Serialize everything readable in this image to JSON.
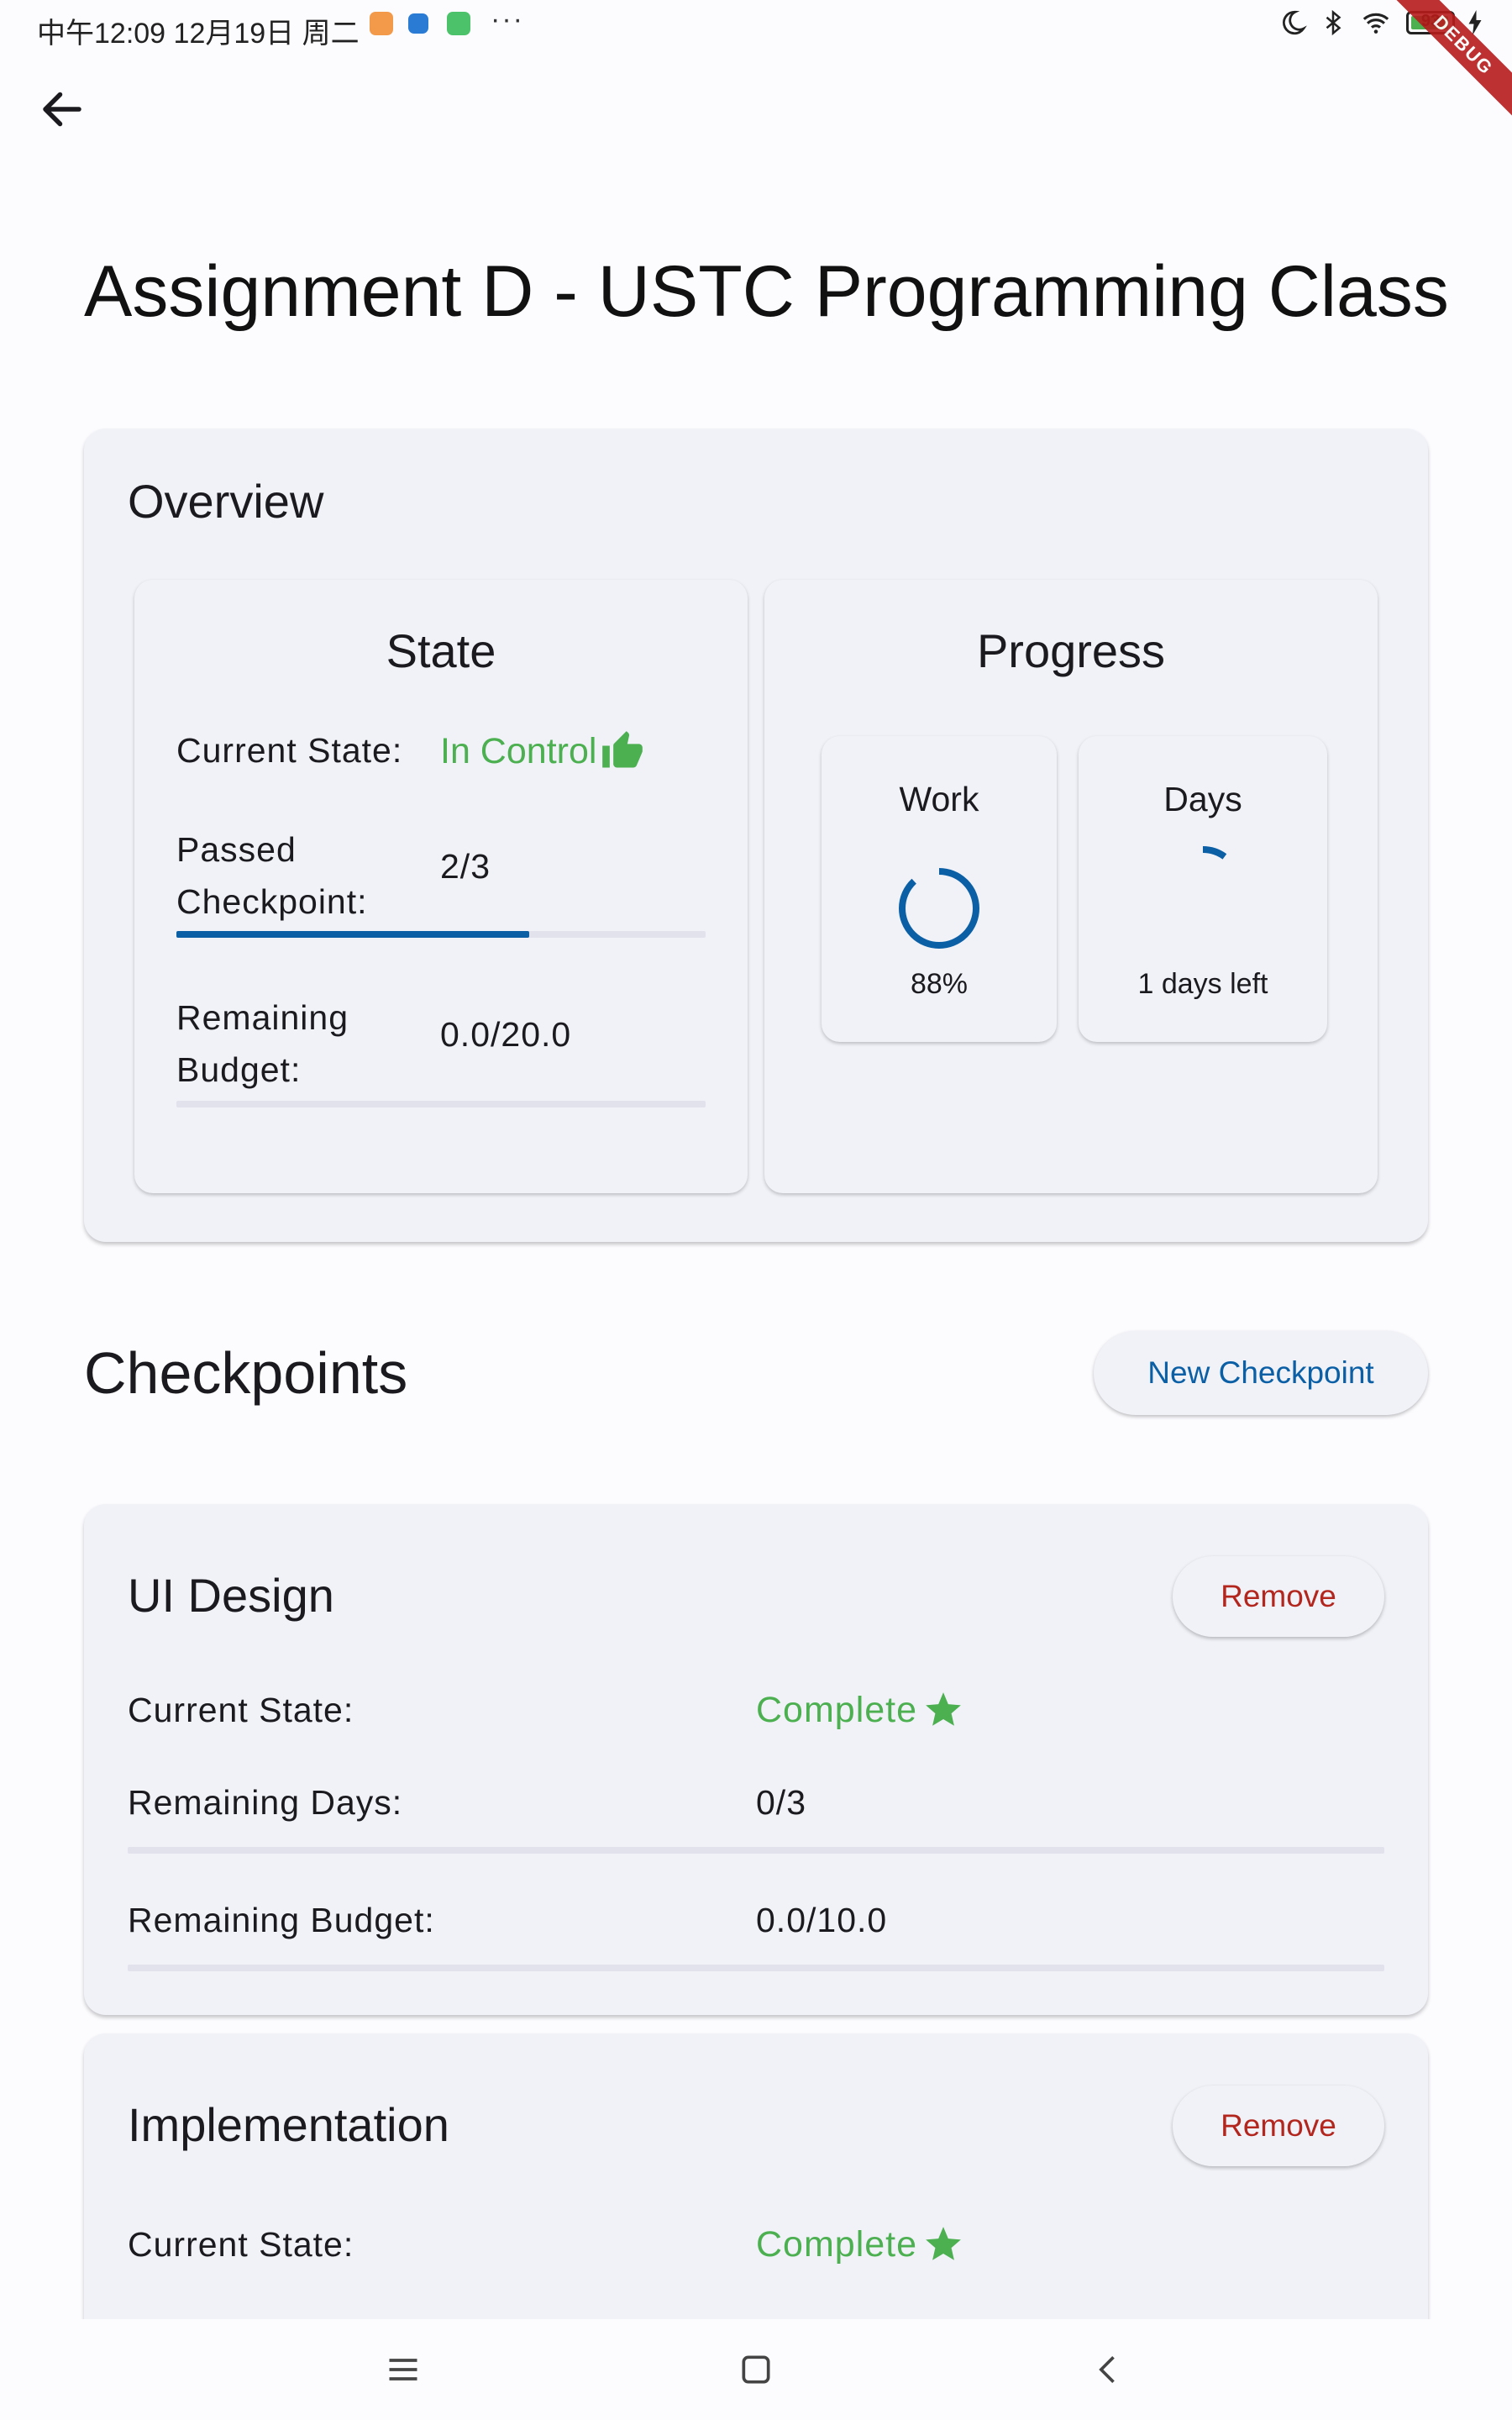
{
  "status_bar": {
    "time": "中午12:09 12月19日 周二",
    "dots": "···",
    "battery": "93",
    "debug": "DEBUG"
  },
  "page": {
    "title": "Assignment D - USTC Programming Class"
  },
  "overview": {
    "heading": "Overview",
    "state": {
      "heading": "State",
      "current_state_label": "Current State:",
      "current_state_value": "In Control",
      "passed_label_line1": "Passed",
      "passed_label_line2": "Checkpoint:",
      "passed_value": "2/3",
      "passed_progress": 0.667,
      "budget_label_line1": "Remaining",
      "budget_label_line2": "Budget:",
      "budget_value": "0.0/20.0",
      "budget_progress": 0.0
    },
    "progress": {
      "heading": "Progress",
      "work": {
        "label": "Work",
        "value": "88%",
        "fraction": 0.88
      },
      "days": {
        "label": "Days",
        "value": "1 days left",
        "fraction": 0.1
      }
    }
  },
  "checkpoints": {
    "heading": "Checkpoints",
    "new_button": "New Checkpoint",
    "items": [
      {
        "name": "UI Design",
        "remove_label": "Remove",
        "current_state_label": "Current State:",
        "current_state_value": "Complete",
        "days_label": "Remaining Days:",
        "days_value": "0/3",
        "days_progress": 0.0,
        "budget_label": "Remaining Budget:",
        "budget_value": "0.0/10.0",
        "budget_progress": 0.0
      },
      {
        "name": "Implementation",
        "remove_label": "Remove",
        "current_state_label": "Current State:",
        "current_state_value": "Complete"
      }
    ]
  },
  "colors": {
    "accent": "#0b5fa5",
    "success": "#4caf50",
    "danger": "#b3261e",
    "card": "#f0f2f8"
  }
}
